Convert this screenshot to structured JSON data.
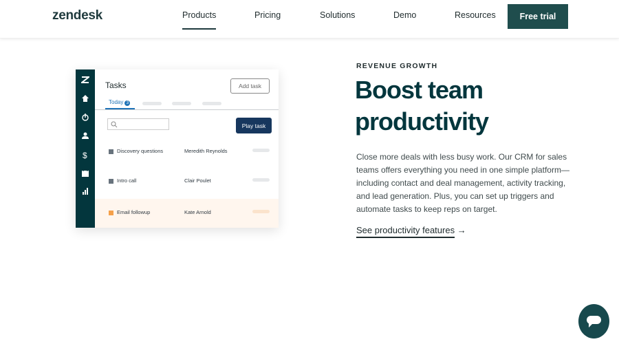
{
  "header": {
    "logo": "zendesk",
    "nav": [
      {
        "label": "Products",
        "active": true
      },
      {
        "label": "Pricing"
      },
      {
        "label": "Solutions"
      },
      {
        "label": "Demo"
      },
      {
        "label": "Resources"
      }
    ],
    "cta": "Free trial"
  },
  "mockup": {
    "title": "Tasks",
    "add_task": "Add task",
    "tab": "Today",
    "tab_count": "3",
    "play_task": "Play task",
    "sidebar_icons": [
      "zendesk-logo-icon",
      "home-icon",
      "deals-icon",
      "person-icon",
      "dollar-icon",
      "calendar-icon",
      "chart-icon"
    ],
    "rows": [
      {
        "task": "Discovery questions",
        "person": "Meredith Reynolds",
        "status_color": "#68737d"
      },
      {
        "task": "Intro call",
        "person": "Clair Poulet",
        "status_color": "#68737d"
      },
      {
        "task": "Email followup",
        "person": "Kate Arnold",
        "status_color": "#f5a04a",
        "highlighted": true
      }
    ]
  },
  "content": {
    "eyebrow": "REVENUE GROWTH",
    "title": "Boost team productivity",
    "body": "Close more deals with less busy work. Our CRM for sales teams offers everything you need in one simple platform—including contact and deal management, activity tracking, and lead generation. Plus, you can set up triggers and automate tasks to keep reps on target.",
    "link": "See productivity features",
    "link_arrow": "→"
  },
  "colors": {
    "brand": "#03363d",
    "cta": "#1f4d4d",
    "accent": "#1f73b7",
    "highlight": "#fff6ee"
  }
}
